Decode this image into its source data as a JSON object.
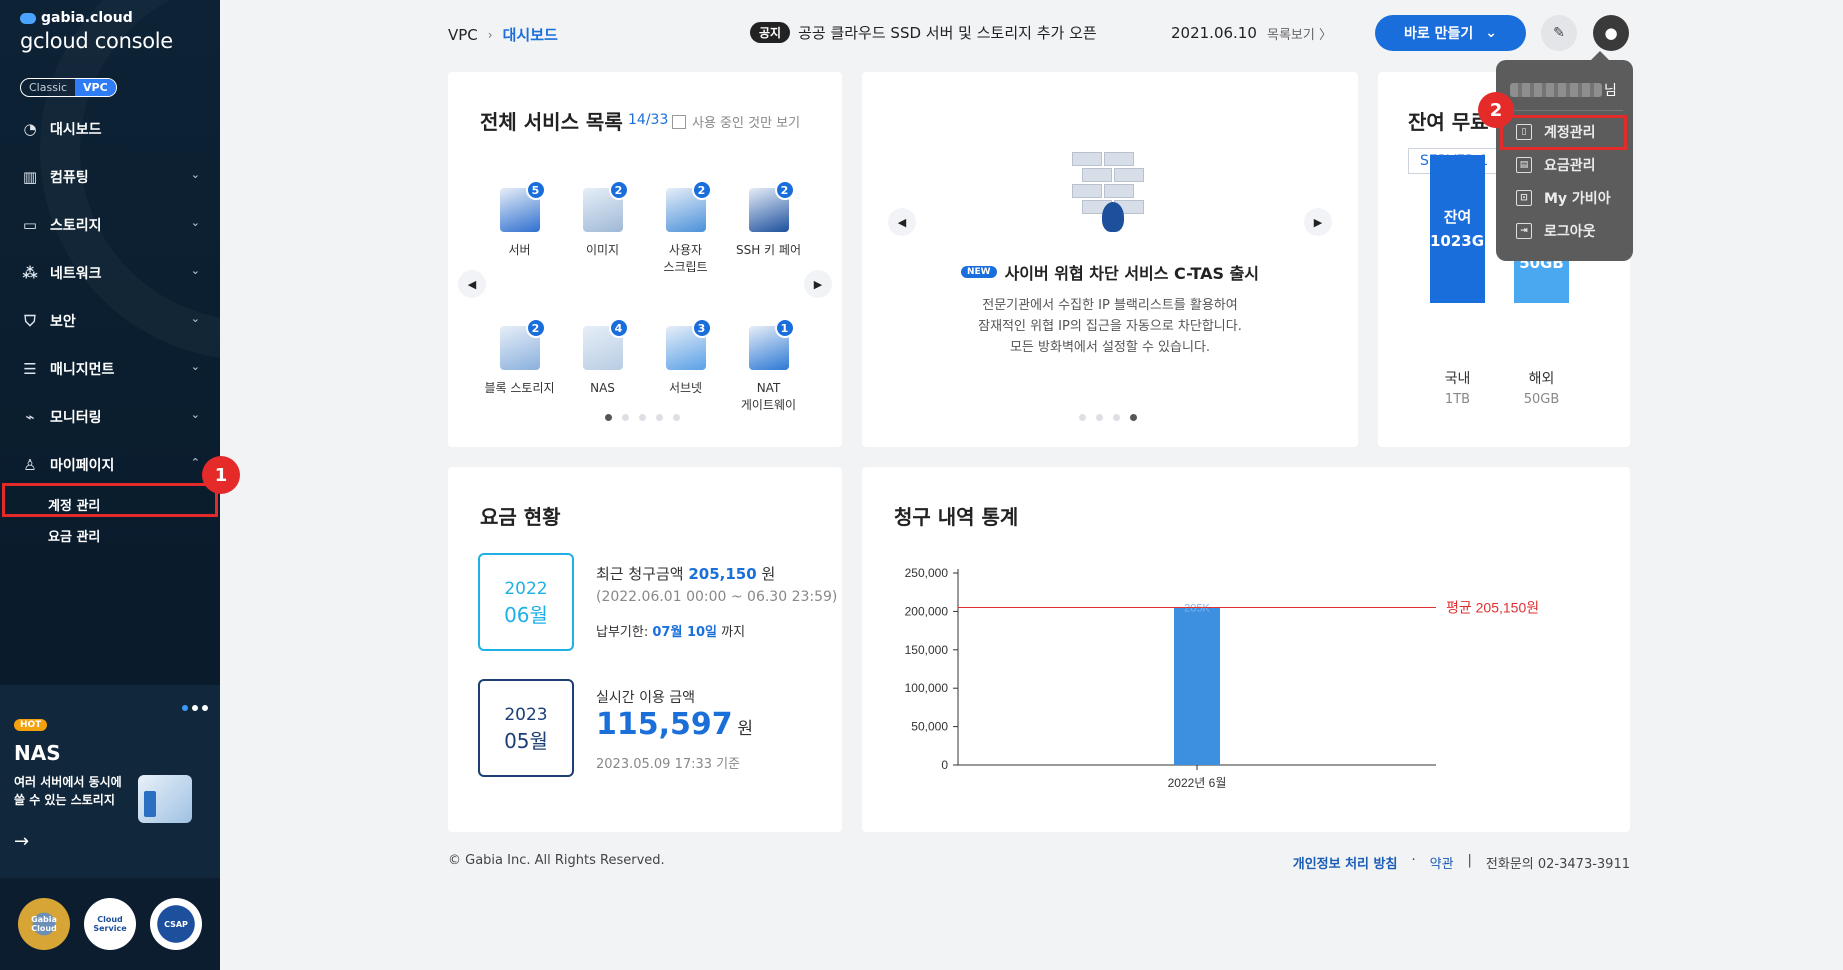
{
  "sidebar": {
    "brand_small": "gabia.cloud",
    "brand_big": "gcloud console",
    "mode_classic": "Classic",
    "mode_vpc": "VPC",
    "items": [
      {
        "label": "대시보드",
        "icon": "dashboard-icon",
        "glyph": "◔"
      },
      {
        "label": "컴퓨팅",
        "icon": "chip-icon",
        "glyph": "▥"
      },
      {
        "label": "스토리지",
        "icon": "storage-icon",
        "glyph": "▭"
      },
      {
        "label": "네트워크",
        "icon": "network-icon",
        "glyph": "⁂"
      },
      {
        "label": "보안",
        "icon": "shield-icon",
        "glyph": "⛉"
      },
      {
        "label": "매니지먼트",
        "icon": "management-icon",
        "glyph": "☰"
      },
      {
        "label": "모니터링",
        "icon": "monitoring-icon",
        "glyph": "⌁"
      },
      {
        "label": "마이페이지",
        "icon": "user-icon",
        "glyph": "♙"
      }
    ],
    "chevron_down": "⌄",
    "chevron_up": "⌃",
    "sub_items": [
      "계정 관리",
      "요금 관리"
    ],
    "step1": "1",
    "promo": {
      "hot": "HOT",
      "title": "NAS",
      "desc": "여러 서버에서 동시에 쓸 수 있는 스토리지",
      "arrow": "→"
    },
    "certs": [
      "Gabia Cloud",
      "Cloud Service",
      "CSAP"
    ]
  },
  "topbar": {
    "crumb_root": "VPC",
    "crumb_sep": "›",
    "crumb_current": "대시보드",
    "notice_tag": "공지",
    "notice_text": "공공 클라우드 SSD 서버 및 스토리지 추가 오픈",
    "notice_date": "2021.06.10",
    "notice_more": "목록보기 〉",
    "make_label": "바로 만들기",
    "make_chevron": "⌄",
    "chat_glyph": "✎",
    "user_glyph": "●"
  },
  "services": {
    "title": "전체 서비스 목록",
    "count": "14/33",
    "filter_label": "사용 중인 것만 보기",
    "items": [
      {
        "label": "서버",
        "num": "5",
        "color": "#2f6fcf"
      },
      {
        "label": "이미지",
        "num": "2",
        "color": "#9fb9d6"
      },
      {
        "label": "사용자\n스크립트",
        "num": "2",
        "color": "#4a90d9"
      },
      {
        "label": "SSH 키 페어",
        "num": "2",
        "color": "#1c4f9c"
      },
      {
        "label": "블록 스토리지",
        "num": "2",
        "color": "#8ab0dd"
      },
      {
        "label": "NAS",
        "num": "4",
        "color": "#b8cde3"
      },
      {
        "label": "서브넷",
        "num": "3",
        "color": "#5aa0e6"
      },
      {
        "label": "NAT\n게이트웨이",
        "num": "1",
        "color": "#2c78d4"
      }
    ],
    "prev": "◀",
    "next": "▶"
  },
  "banner": {
    "new_tag": "NEW",
    "title": "사이버 위협 차단 서비스 C-TAS 출시",
    "desc1": "전문기관에서 수집한 IP 블랙리스트를 활용하여",
    "desc2": "잠재적인 위협 IP의 집근을 자동으로 차단합니다.",
    "desc3": "모든 방화벽에서 설정할 수 있습니다."
  },
  "remaining": {
    "title": "잔여 무료",
    "server": "SERVER-1",
    "bars": [
      {
        "label": "국내",
        "total": "1TB",
        "text1": "잔여",
        "text2": "1023GB",
        "color": "#1a6edb",
        "fraction": 1.0
      },
      {
        "label": "해외",
        "total": "50GB",
        "text1": "잔여",
        "text2": "50GB",
        "color": "#4aa8f0",
        "fraction": 0.7
      }
    ]
  },
  "fees": {
    "title": "요금 현황",
    "box1_year": "2022",
    "box1_month": "06월",
    "recent_label": "최근 청구금액",
    "recent_amount": "205,150",
    "won": "원",
    "recent_period": "(2022.06.01 00:00 ~ 06.30 23:59)",
    "due_label": "납부기한:",
    "due_date": "07월 10일",
    "due_suffix": "까지",
    "box2_year": "2023",
    "box2_month": "05월",
    "realtime_label": "실시간 이용 금액",
    "realtime_amount": "115,597",
    "realtime_time": "2023.05.09 17:33 기준"
  },
  "billing": {
    "title": "청구 내역 통계",
    "avg_label": "평균 205,150원"
  },
  "chart_data": {
    "type": "bar",
    "categories": [
      "2022년 6월"
    ],
    "values": [
      205150
    ],
    "data_labels": [
      "205K"
    ],
    "average": 205150,
    "yticks": [
      0,
      50000,
      100000,
      150000,
      200000,
      250000
    ],
    "ytick_labels": [
      "0",
      "50,000",
      "100,000",
      "150,000",
      "200,000",
      "250,000"
    ],
    "ylim": [
      0,
      250000
    ],
    "bar_color": "#3d8fe0",
    "avg_color": "#e03030"
  },
  "dropdown": {
    "suffix": "님",
    "items": [
      {
        "label": "계정관리",
        "icon": "account-icon",
        "glyph": "▯"
      },
      {
        "label": "요금관리",
        "icon": "billing-icon",
        "glyph": "▤"
      },
      {
        "label": "My 가비아",
        "icon": "my-gabia-icon",
        "glyph": "⊡"
      },
      {
        "label": "로그아웃",
        "icon": "logout-icon",
        "glyph": "⇥"
      }
    ],
    "step2": "2"
  },
  "footer": {
    "copyright": "© Gabia Inc. All Rights Reserved.",
    "privacy": "개인정보 처리 방침",
    "dot": "·",
    "terms": "약관",
    "bar": "|",
    "contact": "전화문의  02-3473-3911"
  }
}
